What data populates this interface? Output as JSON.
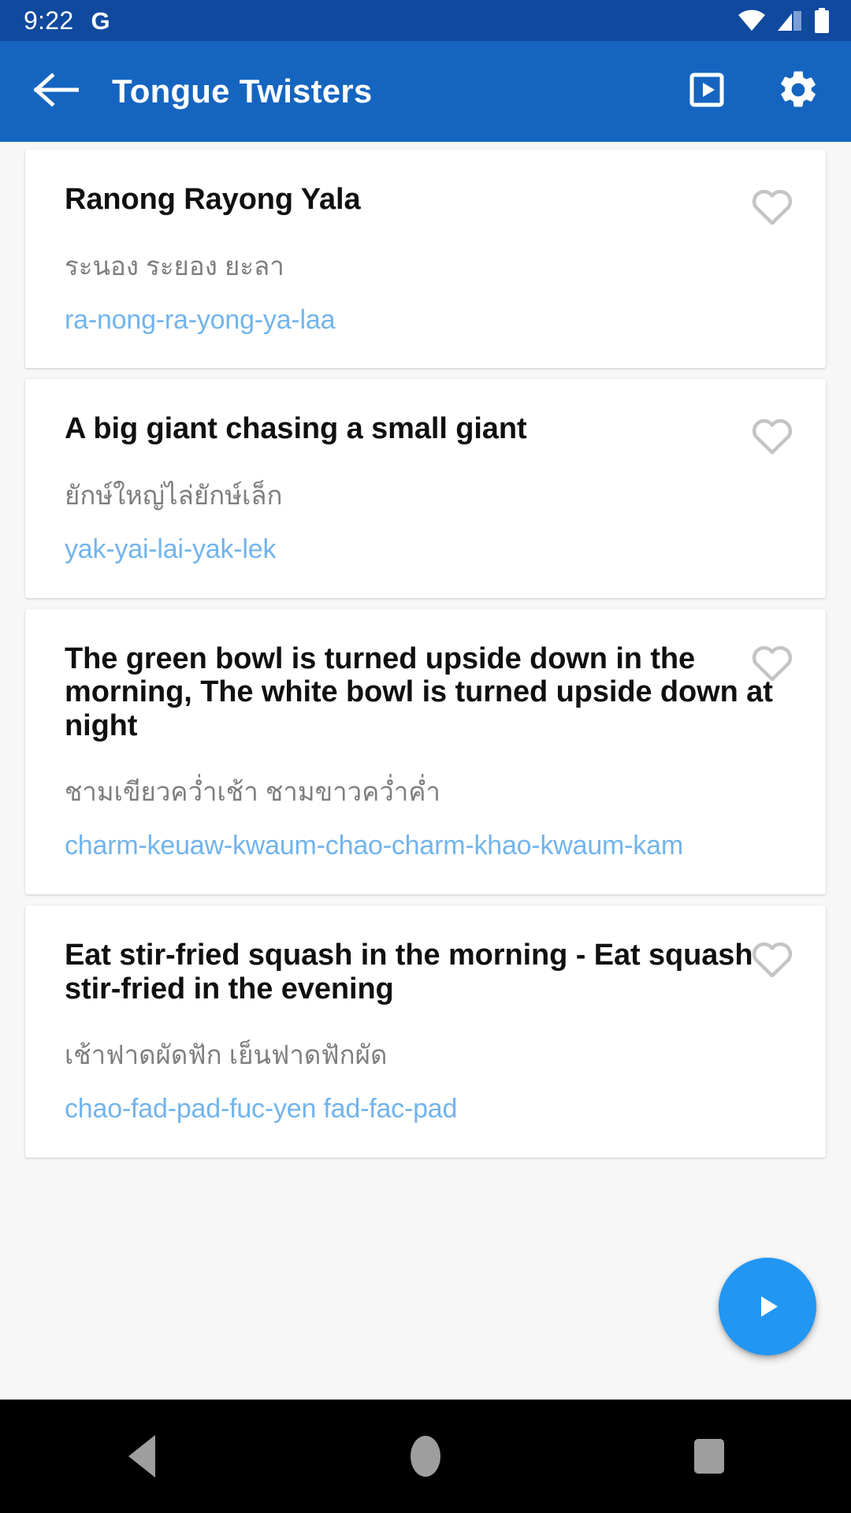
{
  "status_bar": {
    "time": "9:22",
    "google_glyph": "G",
    "icons": [
      "wifi-icon",
      "signal-icon",
      "battery-icon"
    ]
  },
  "app_bar": {
    "back_icon": "back-arrow-icon",
    "title": "Tongue Twisters",
    "actions": [
      {
        "icon": "slideshow-icon",
        "label": "Slideshow"
      },
      {
        "icon": "gear-icon",
        "label": "Settings"
      }
    ]
  },
  "colors": {
    "status_bar": "#10499e",
    "app_bar": "#1565c0",
    "accent": "#2196f3",
    "roman_text": "#72b4ec",
    "thai_text": "#7e7e7e",
    "title_text": "#101010",
    "heart_outline": "#c4c4c4",
    "page_bg": "#f7f7f7",
    "nav_bar": "#000000",
    "nav_icon": "#9e9e9e"
  },
  "list": {
    "favorite_icon": "heart-outline-icon",
    "items": [
      {
        "title": "Ranong Rayong Yala",
        "thai": "ระนอง ระยอง ยะลา",
        "roman": "ra-nong-ra-yong-ya-laa",
        "favorited": false
      },
      {
        "title": "A big giant chasing a small giant",
        "thai": "ยักษ์ใหญ่ไล่ยักษ์เล็ก",
        "roman": "yak-yai-lai-yak-lek",
        "favorited": false
      },
      {
        "title": "The green bowl is turned upside down in the morning,  The white bowl is turned upside down at night",
        "thai": "ชามเขียวคว่ำเช้า ชามขาวคว่ำค่ำ",
        "roman": "charm-keuaw-kwaum-chao-charm-khao-kwaum-kam",
        "favorited": false
      },
      {
        "title": "Eat stir-fried squash in the morning -  Eat squash stir-fried in the evening",
        "thai": "เช้าฟาดผัดฟัก เย็นฟาดฟักผัด",
        "roman": "chao-fad-pad-fuc-yen fad-fac-pad",
        "favorited": false
      }
    ]
  },
  "fab": {
    "icon": "play-icon",
    "label": "Play"
  },
  "nav_bar": {
    "buttons": [
      {
        "icon": "nav-back-icon",
        "label": "Back"
      },
      {
        "icon": "nav-home-icon",
        "label": "Home"
      },
      {
        "icon": "nav-recents-icon",
        "label": "Recents"
      }
    ]
  }
}
